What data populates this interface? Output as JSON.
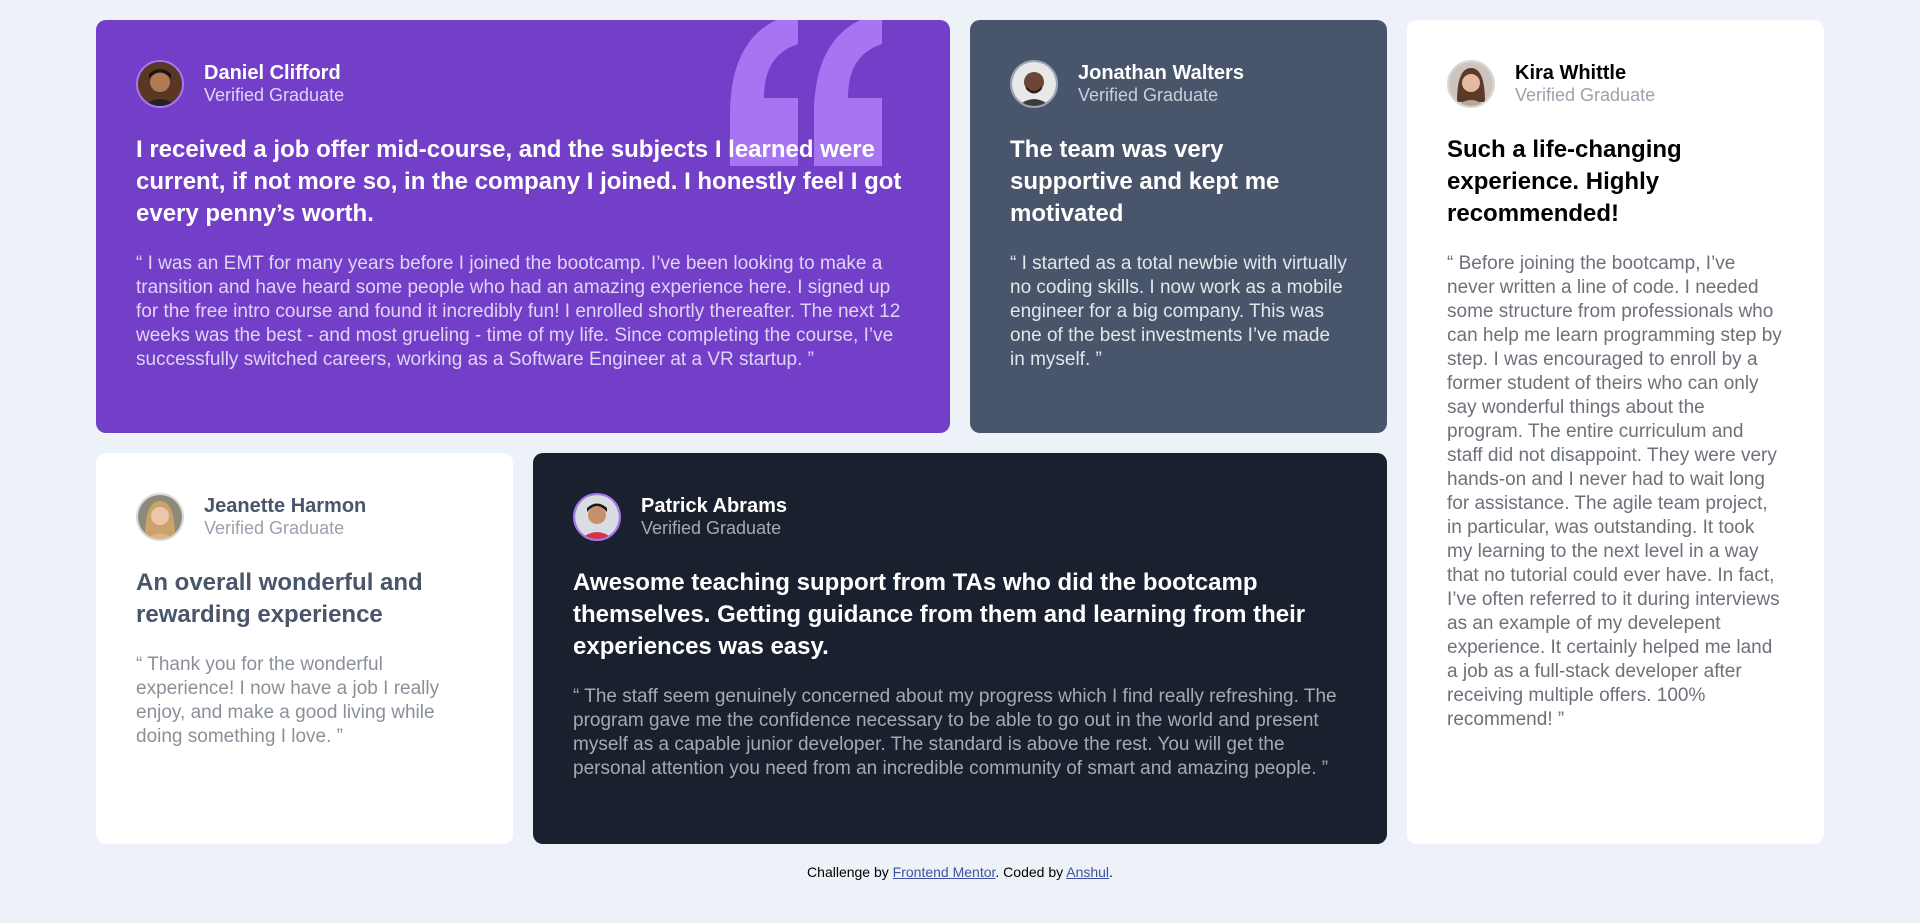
{
  "testimonials": [
    {
      "name": "Daniel Clifford",
      "role": "Verified Graduate",
      "headline": "I received a job offer mid-course, and the subjects I learned were current, if not more so, in the company I joined. I honestly feel I got every penny’s worth.",
      "quote": "“ I was an EMT for many years before I joined the bootcamp. I’ve been looking to make a transition and have heard some people who had an amazing experience here. I signed up for the free intro course and found it incredibly fun! I enrolled shortly thereafter. The next 12 weeks was the best - and most grueling - time of my life. Since completing the course, I’ve successfully switched careers, working as a Software Engineer at a VR startup. ”",
      "background": "#733FC8"
    },
    {
      "name": "Jonathan Walters",
      "role": "Verified Graduate",
      "headline": "The team was very supportive and kept me motivated",
      "quote": "“ I started as a total newbie with virtually no coding skills. I now work as a mobile engineer for a big company. This was one of the best investments I’ve made in myself. ”",
      "background": "#48556A"
    },
    {
      "name": "Kira Whittle",
      "role": "Verified Graduate",
      "headline": "Such a life-changing experience. Highly recommended!",
      "quote": "“ Before joining the bootcamp, I’ve never written a line of code. I needed some structure from professionals who can help me learn programming step by step. I was encouraged to enroll by a former student of theirs who can only say wonderful things about the program. The entire curriculum and staff did not disappoint. They were very hands-on and I never had to wait long for assistance. The agile team project, in particular, was outstanding. It took my learning to the next level in a way that no tutorial could ever have. In fact, I’ve often referred to it during interviews as an example of my develepent experience. It certainly helped me land a job as a full-stack developer after receiving multiple offers. 100% recommend! ”",
      "background": "#FFFFFF"
    },
    {
      "name": "Jeanette Harmon",
      "role": "Verified Graduate",
      "headline": "An overall wonderful and rewarding experience",
      "quote": "“ Thank you for the wonderful experience! I now have a job I really enjoy, and make a good living while doing something I love. ”",
      "background": "#FFFFFF"
    },
    {
      "name": "Patrick Abrams",
      "role": "Verified Graduate",
      "headline": "Awesome teaching support from TAs who did the bootcamp themselves. Getting guidance from them and learning from their experiences was easy.",
      "quote": "“ The staff seem genuinely concerned about my progress which I find really refreshing. The program gave me the confidence necessary to be able to go out in the world and present myself as a capable junior developer. The standard is above the rest. You will get the personal attention you need from an incredible community of smart and amazing people. ”",
      "background": "#19212E"
    }
  ],
  "attribution": {
    "prefix": "Challenge by ",
    "link1": "Frontend Mentor",
    "middle": ". Coded by ",
    "link2": "Anshul",
    "suffix": "."
  },
  "colors": {
    "page_background": "#ECF2F8",
    "quote_mark": "#A775F1",
    "link": "#3E52A3"
  }
}
